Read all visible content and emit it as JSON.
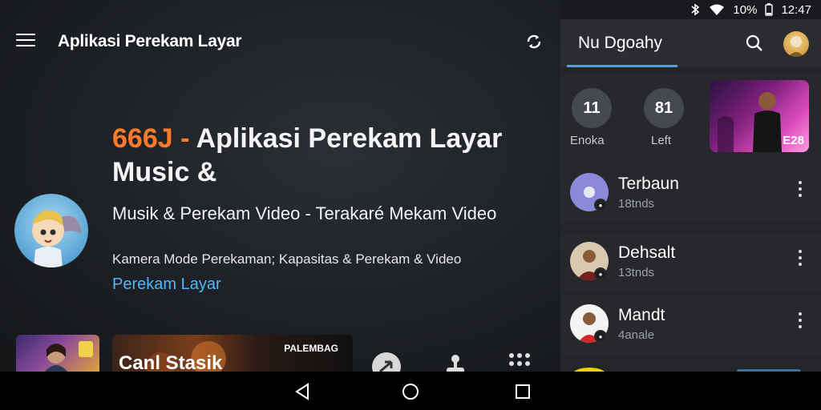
{
  "status_bar": {
    "battery": "10%",
    "time": "12:47"
  },
  "app_bar": {
    "title": "Aplikasi Perekam Layar",
    "icons": [
      "menu-icon",
      "sync-icon"
    ]
  },
  "hero": {
    "title_accent": "666J - ",
    "title_main": "Aplikasi Perekam Layar Music &",
    "subtitle": "Musik & Perekam Video - Terakaré Mekam Video",
    "description": "Kamera Mode Perekaman; Kapasitas & Perekam & Video",
    "link": "Perekam Layar"
  },
  "bottom_row": {
    "thumb2_title": "Canl Stasik",
    "thumb2_badge": "PALEMBAG"
  },
  "panel": {
    "tab_label": "Nu Dgoahy",
    "stats": [
      {
        "value": "11",
        "label": "Enoka"
      },
      {
        "value": "81",
        "label": "Left"
      }
    ],
    "thumb_label": "E28",
    "items": [
      {
        "title": "Terbaun",
        "subtitle": "18tnds"
      },
      {
        "title": "Dehsalt",
        "subtitle": "13tnds"
      },
      {
        "title": "Mandt",
        "subtitle": "4anale"
      }
    ]
  },
  "colors": {
    "accent_orange": "#ff7a2a",
    "link_blue": "#4db8ff",
    "tab_underline": "#5b9bd5",
    "panel_bg": "#232528"
  }
}
